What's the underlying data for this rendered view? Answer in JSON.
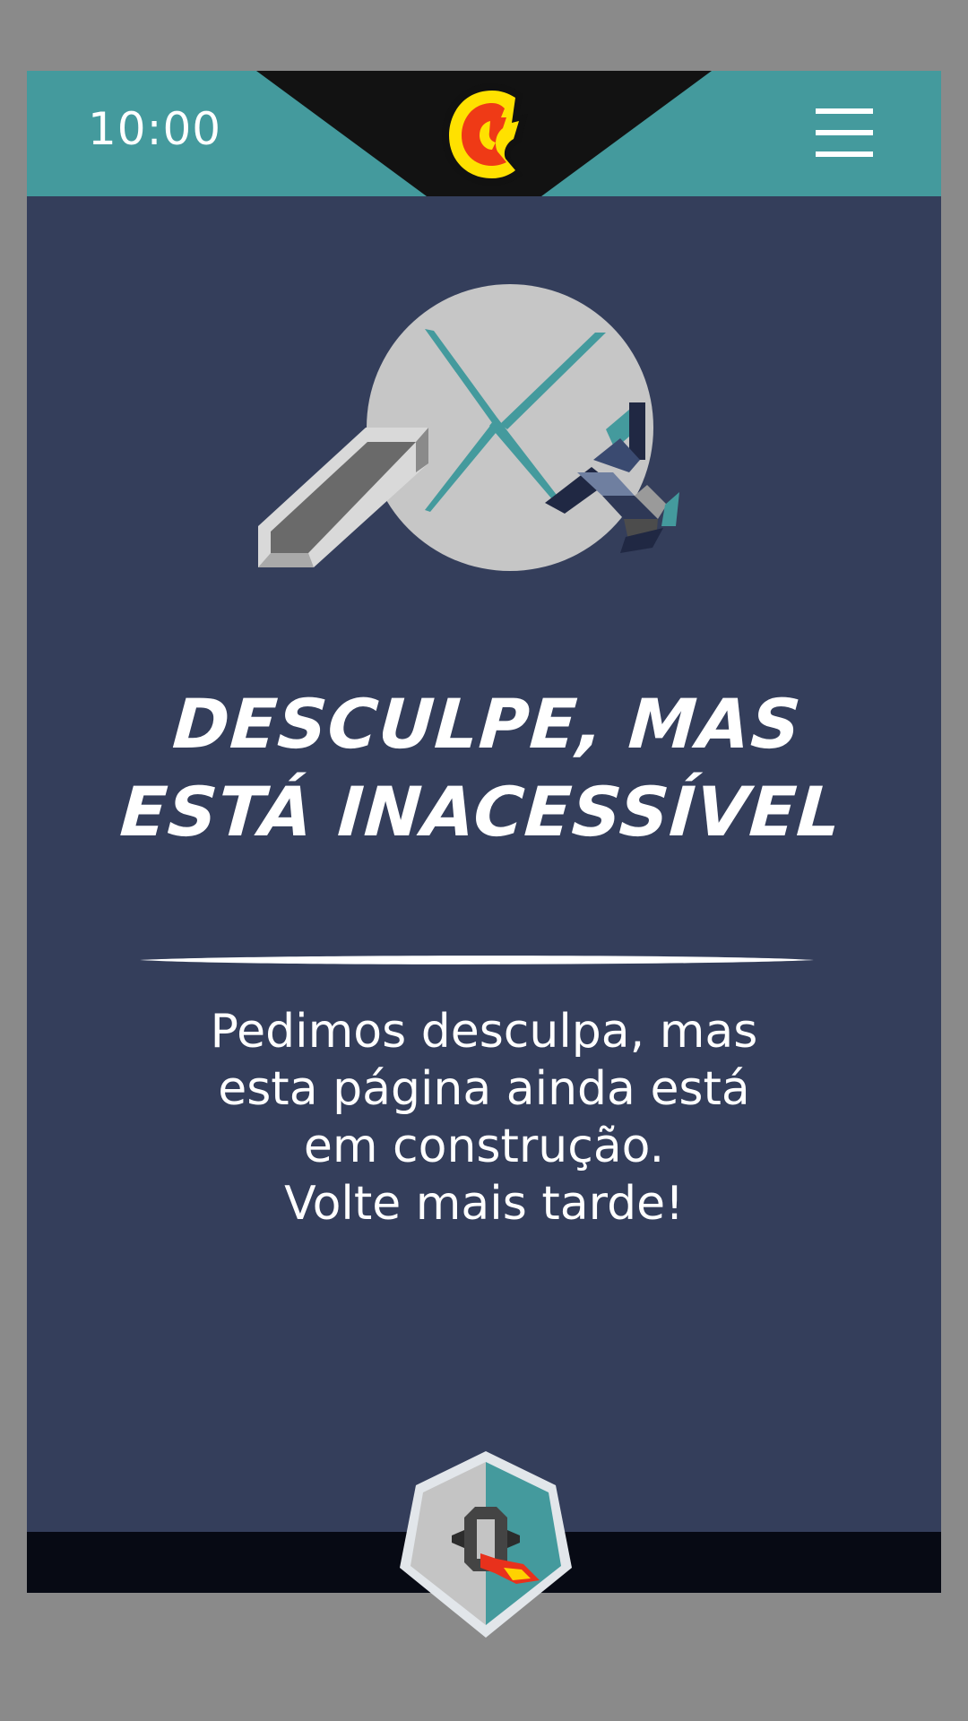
{
  "status_bar": {
    "time": "10:00"
  },
  "header": {
    "logo_icon": "c-comic-logo-icon",
    "menu_icon": "hamburger-menu-icon"
  },
  "hero": {
    "icon": "crossed-swords-icon"
  },
  "error": {
    "title_line1": "DESCULPE, MAS",
    "title_line2": "ESTÁ INACESSÍVEL",
    "message_lines": [
      "Pedimos desculpa, mas",
      "esta página ainda está",
      "em construção.",
      "Volte mais tarde!"
    ]
  },
  "footer": {
    "badge_icon": "hexagon-q-emblem-icon"
  },
  "colors": {
    "background": "#343e5b",
    "teal": "#449a9d",
    "black_notch": "#121212",
    "bottom_bar": "#070a14",
    "outer_gray": "#8a8a8a",
    "logo_yellow": "#ffe100",
    "logo_red": "#ef3a16"
  }
}
